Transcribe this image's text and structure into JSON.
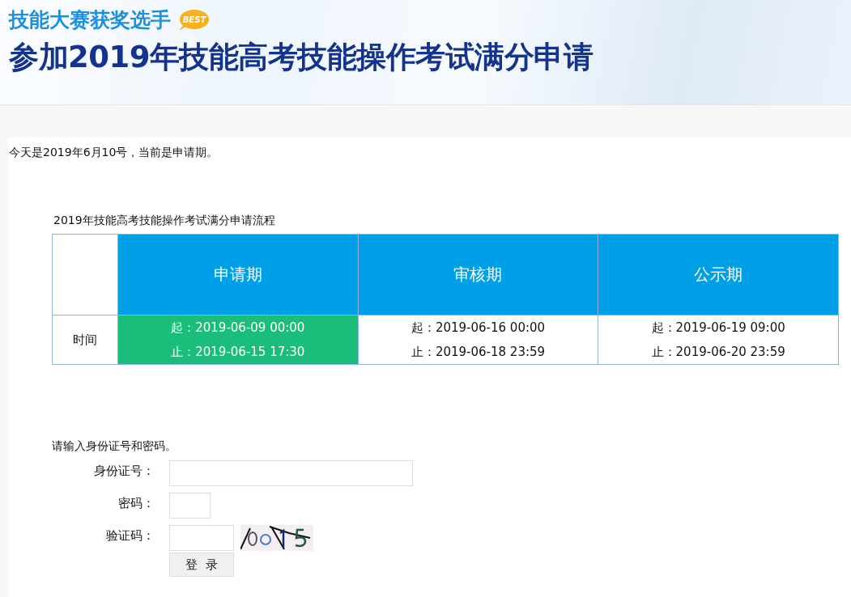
{
  "header": {
    "subtitle": "技能大赛获奖选手",
    "badge": "BEST",
    "title": "参加2019年技能高考技能操作考试满分申请"
  },
  "notice": "今天是2019年6月10号，当前是申请期。",
  "process": {
    "caption": "2019年技能高考技能操作考试满分申请流程",
    "row_label": "时间",
    "phases": [
      {
        "name": "申请期",
        "start": "起：2019-06-09 00:00",
        "end": "止：2019-06-15 17:30",
        "selected": true
      },
      {
        "name": "审核期",
        "start": "起：2019-06-16 00:00",
        "end": "止：2019-06-18 23:59",
        "selected": false
      },
      {
        "name": "公示期",
        "start": "起：2019-06-19 09:00",
        "end": "止：2019-06-20 23:59",
        "selected": false
      }
    ]
  },
  "login": {
    "prompt": "请输入身份证号和密码。",
    "fields": [
      {
        "kind": "id",
        "label": "身份证号："
      },
      {
        "kind": "password",
        "label": "密码："
      },
      {
        "kind": "captcha",
        "label": "验证码："
      }
    ],
    "button": "登  录"
  }
}
